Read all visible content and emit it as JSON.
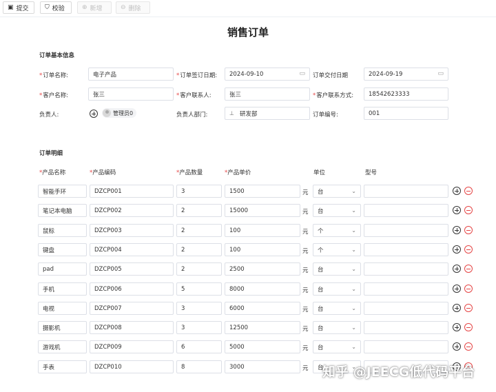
{
  "toolbar": {
    "submit": "提交",
    "verify": "校验",
    "add": "新增",
    "delete": "删除"
  },
  "title": "销售订单",
  "basic": {
    "section": "订单基本信息",
    "order_name_label": "订单名称:",
    "order_name": "电子产品",
    "sign_date_label": "订单签订日期:",
    "sign_date": "2024-09-10",
    "delivery_date_label": "订单交付日期",
    "delivery_date": "2024-09-19",
    "customer_name_label": "客户名称:",
    "customer_name": "张三",
    "contact_label": "客户联系人:",
    "contact": "张三",
    "contact_method_label": "客户联系方式:",
    "contact_method": "18542623333",
    "owner_label": "负责人:",
    "owner": "管理员0",
    "owner_dept_label": "负责人部门:",
    "owner_dept": "研发部",
    "order_no_label": "订单编号:",
    "order_no": "001"
  },
  "detail": {
    "section": "订单明细",
    "headers": {
      "name": "产品名称",
      "code": "产品编码",
      "qty": "产品数量",
      "price": "产品单价",
      "unit": "单位",
      "model": "型号"
    },
    "currency": "元",
    "rows": [
      {
        "name": "智能手环",
        "code": "DZCP001",
        "qty": "3",
        "price": "1500",
        "unit": "台",
        "model": ""
      },
      {
        "name": "笔记本电脑",
        "code": "DZCP002",
        "qty": "2",
        "price": "15000",
        "unit": "台",
        "model": ""
      },
      {
        "name": "鼠标",
        "code": "DZCP003",
        "qty": "2",
        "price": "100",
        "unit": "个",
        "model": ""
      },
      {
        "name": "键盘",
        "code": "DZCP004",
        "qty": "2",
        "price": "100",
        "unit": "个",
        "model": ""
      },
      {
        "name": "pad",
        "code": "DZCP005",
        "qty": "2",
        "price": "2500",
        "unit": "台",
        "model": ""
      },
      {
        "name": "手机",
        "code": "DZCP006",
        "qty": "5",
        "price": "8000",
        "unit": "台",
        "model": ""
      },
      {
        "name": "电视",
        "code": "DZCP007",
        "qty": "3",
        "price": "6000",
        "unit": "台",
        "model": ""
      },
      {
        "name": "摄影机",
        "code": "DZCP008",
        "qty": "3",
        "price": "12500",
        "unit": "台",
        "model": ""
      },
      {
        "name": "游戏机",
        "code": "DZCP009",
        "qty": "6",
        "price": "5000",
        "unit": "台",
        "model": ""
      },
      {
        "name": "手表",
        "code": "DZCP010",
        "qty": "8",
        "price": "3000",
        "unit": "台",
        "model": ""
      }
    ]
  },
  "watermark": "知乎 @JEECG低代码平台",
  "colors": {
    "required": "#e54545",
    "border": "#dcdfe6",
    "remove": "#e54545"
  }
}
